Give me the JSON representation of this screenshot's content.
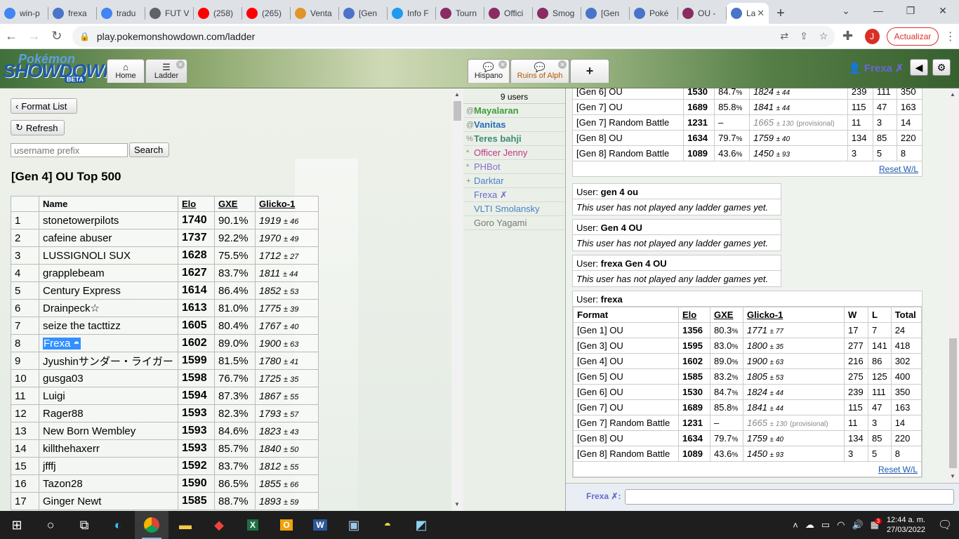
{
  "browser": {
    "tabs": [
      {
        "title": "win-p",
        "icon": "google-icon",
        "color": "#4285f4"
      },
      {
        "title": "frexa",
        "icon": "showdown-icon",
        "color": "#4a74c9"
      },
      {
        "title": "tradu",
        "icon": "google-icon",
        "color": "#4285f4"
      },
      {
        "title": "FUT V",
        "icon": "globe-icon",
        "color": "#5f6368"
      },
      {
        "title": "(258)",
        "icon": "youtube-icon",
        "color": "#ff0000"
      },
      {
        "title": "(265)",
        "icon": "youtube-icon",
        "color": "#ff0000"
      },
      {
        "title": "Venta",
        "icon": "tiger-icon",
        "color": "#e0952a"
      },
      {
        "title": "[Gen",
        "icon": "showdown-icon",
        "color": "#4a74c9"
      },
      {
        "title": "Info F",
        "icon": "twitter-icon",
        "color": "#1d9bf0"
      },
      {
        "title": "Tourn",
        "icon": "smogon-icon",
        "color": "#8a2b62"
      },
      {
        "title": "Offici",
        "icon": "smogon-icon",
        "color": "#8a2b62"
      },
      {
        "title": "Smog",
        "icon": "smogon-icon",
        "color": "#8a2b62"
      },
      {
        "title": "[Gen",
        "icon": "showdown-icon",
        "color": "#4a74c9"
      },
      {
        "title": "Poké",
        "icon": "showdown-icon",
        "color": "#4a74c9"
      },
      {
        "title": "OU -",
        "icon": "smogon-icon",
        "color": "#8a2b62"
      }
    ],
    "active_tab": {
      "title": "La",
      "icon": "showdown-icon",
      "color": "#4a74c9"
    },
    "url": "play.pokemonshowdown.com/ladder",
    "profile_initial": "J",
    "update_button": "Actualizar"
  },
  "showdown": {
    "logo": {
      "line1": "Pokémon",
      "line2": "SHOWDOWN",
      "line3": "BETA"
    },
    "tabs": [
      {
        "label": "Home",
        "icon": "home-icon"
      },
      {
        "label": "Ladder",
        "icon": "ladder-icon"
      }
    ],
    "room_tabs": [
      {
        "label": "Hispano",
        "icon": "chat-icon"
      },
      {
        "label": "Ruins of Alph",
        "icon": "chat-icon"
      }
    ],
    "new_room": "+",
    "username": "Frexa ✗"
  },
  "ladder": {
    "format_list_button": "Format List",
    "refresh_button": "Refresh",
    "search_placeholder": "username prefix",
    "search_button": "Search",
    "title": "[Gen 4] OU Top 500",
    "columns": [
      "",
      "Name",
      "Elo",
      "GXE",
      "Glicko-1"
    ],
    "rows": [
      {
        "rank": "1",
        "name": "stonetowerpilots",
        "elo": "1740",
        "gxe": "90.1%",
        "glicko": "1919",
        "dev": "± 46"
      },
      {
        "rank": "2",
        "name": "cafeine abuser",
        "elo": "1737",
        "gxe": "92.2%",
        "glicko": "1970",
        "dev": "± 49"
      },
      {
        "rank": "3",
        "name": "LUSSIGNOLI SUX",
        "elo": "1628",
        "gxe": "75.5%",
        "glicko": "1712",
        "dev": "± 27"
      },
      {
        "rank": "4",
        "name": "grapplebeam",
        "elo": "1627",
        "gxe": "83.7%",
        "glicko": "1811",
        "dev": "± 44"
      },
      {
        "rank": "5",
        "name": "Century Express",
        "elo": "1614",
        "gxe": "86.4%",
        "glicko": "1852",
        "dev": "± 53"
      },
      {
        "rank": "6",
        "name": "Drainpeck☆",
        "elo": "1613",
        "gxe": "81.0%",
        "glicko": "1775",
        "dev": "± 39"
      },
      {
        "rank": "7",
        "name": "seize the tacttizz",
        "elo": "1605",
        "gxe": "80.4%",
        "glicko": "1767",
        "dev": "± 40"
      },
      {
        "rank": "8",
        "name": "Frexa",
        "elo": "1602",
        "gxe": "89.0%",
        "glicko": "1900",
        "dev": "± 63",
        "highlight": true
      },
      {
        "rank": "9",
        "name": "Jyushinサンダー・ライガー",
        "elo": "1599",
        "gxe": "81.5%",
        "glicko": "1780",
        "dev": "± 41"
      },
      {
        "rank": "10",
        "name": "gusga03",
        "elo": "1598",
        "gxe": "76.7%",
        "glicko": "1725",
        "dev": "± 35"
      },
      {
        "rank": "11",
        "name": "Luigi",
        "elo": "1594",
        "gxe": "87.3%",
        "glicko": "1867",
        "dev": "± 55"
      },
      {
        "rank": "12",
        "name": "Rager88",
        "elo": "1593",
        "gxe": "82.3%",
        "glicko": "1793",
        "dev": "± 57"
      },
      {
        "rank": "13",
        "name": "New Born Wembley",
        "elo": "1593",
        "gxe": "84.6%",
        "glicko": "1823",
        "dev": "± 43"
      },
      {
        "rank": "14",
        "name": "killthehaxerr",
        "elo": "1593",
        "gxe": "85.7%",
        "glicko": "1840",
        "dev": "± 50"
      },
      {
        "rank": "15",
        "name": "jfffj",
        "elo": "1592",
        "gxe": "83.7%",
        "glicko": "1812",
        "dev": "± 55"
      },
      {
        "rank": "16",
        "name": "Tazon28",
        "elo": "1590",
        "gxe": "86.5%",
        "glicko": "1855",
        "dev": "± 66"
      },
      {
        "rank": "17",
        "name": "Ginger Newt",
        "elo": "1585",
        "gxe": "88.7%",
        "glicko": "1893",
        "dev": "± 59"
      }
    ]
  },
  "userlist": {
    "count": "9 users",
    "users": [
      {
        "group": "@",
        "name": "Mayalaran",
        "color": "#3f9b3f",
        "bold": true
      },
      {
        "group": "@",
        "name": "Vanitas",
        "color": "#2a6bb8",
        "bold": true
      },
      {
        "group": "%",
        "name": "Teres bahji",
        "color": "#3e8a78",
        "bold": true
      },
      {
        "group": "*",
        "name": "Officer Jenny",
        "color": "#c3338a",
        "bold": false
      },
      {
        "group": "*",
        "name": "PHBot",
        "color": "#8a6fd0",
        "bold": false
      },
      {
        "group": "+",
        "name": "Darktar",
        "color": "#4f7ec7",
        "bold": false
      },
      {
        "group": "",
        "name": "Frexa ✗",
        "color": "#6b67d3",
        "bold": false
      },
      {
        "group": "",
        "name": "VLTI Smolansky",
        "color": "#4a80c8",
        "bold": false
      },
      {
        "group": "",
        "name": "Goro Yagami",
        "color": "#777777",
        "bold": false
      }
    ]
  },
  "top_partial": {
    "rows": [
      {
        "format": "[Gen 6] OU",
        "elo": "1530",
        "gxe": "84.7",
        "glicko": "1824",
        "dev": "± 44",
        "provisional": "",
        "w": "239",
        "l": "111",
        "total": "350"
      },
      {
        "format": "[Gen 7] OU",
        "elo": "1689",
        "gxe": "85.8",
        "glicko": "1841",
        "dev": "± 44",
        "provisional": "",
        "w": "115",
        "l": "47",
        "total": "163"
      },
      {
        "format": "[Gen 7] Random Battle",
        "elo": "1231",
        "gxe": "–",
        "glicko": "1665",
        "dev": "± 130",
        "provisional": "(provisional)",
        "w": "11",
        "l": "3",
        "total": "14"
      },
      {
        "format": "[Gen 8] OU",
        "elo": "1634",
        "gxe": "79.7",
        "glicko": "1759",
        "dev": "± 40",
        "provisional": "",
        "w": "134",
        "l": "85",
        "total": "220"
      },
      {
        "format": "[Gen 8] Random Battle",
        "elo": "1089",
        "gxe": "43.6",
        "glicko": "1450",
        "dev": "± 93",
        "provisional": "",
        "w": "3",
        "l": "5",
        "total": "8"
      }
    ],
    "reset": "Reset W/L"
  },
  "empty_users": [
    {
      "prefix": "User: ",
      "name": "gen 4 ou",
      "message": "This user has not played any ladder games yet."
    },
    {
      "prefix": "User: ",
      "name": "Gen 4 OU",
      "message": "This user has not played any ladder games yet."
    },
    {
      "prefix": "User: ",
      "name": "frexa Gen 4 OU",
      "message": "This user has not played any ladder games yet."
    }
  ],
  "frexa": {
    "prefix": "User: ",
    "name": "frexa",
    "columns": [
      "Format",
      "Elo",
      "GXE",
      "Glicko-1",
      "W",
      "L",
      "Total"
    ],
    "rows": [
      {
        "format": "[Gen 1] OU",
        "elo": "1356",
        "gxe": "80.3",
        "glicko": "1771",
        "dev": "± 77",
        "provisional": "",
        "w": "17",
        "l": "7",
        "total": "24"
      },
      {
        "format": "[Gen 3] OU",
        "elo": "1595",
        "gxe": "83.0",
        "glicko": "1800",
        "dev": "± 35",
        "provisional": "",
        "w": "277",
        "l": "141",
        "total": "418"
      },
      {
        "format": "[Gen 4] OU",
        "elo": "1602",
        "gxe": "89.0",
        "glicko": "1900",
        "dev": "± 63",
        "provisional": "",
        "w": "216",
        "l": "86",
        "total": "302"
      },
      {
        "format": "[Gen 5] OU",
        "elo": "1585",
        "gxe": "83.2",
        "glicko": "1805",
        "dev": "± 53",
        "provisional": "",
        "w": "275",
        "l": "125",
        "total": "400"
      },
      {
        "format": "[Gen 6] OU",
        "elo": "1530",
        "gxe": "84.7",
        "glicko": "1824",
        "dev": "± 44",
        "provisional": "",
        "w": "239",
        "l": "111",
        "total": "350"
      },
      {
        "format": "[Gen 7] OU",
        "elo": "1689",
        "gxe": "85.8",
        "glicko": "1841",
        "dev": "± 44",
        "provisional": "",
        "w": "115",
        "l": "47",
        "total": "163"
      },
      {
        "format": "[Gen 7] Random Battle",
        "elo": "1231",
        "gxe": "–",
        "glicko": "1665",
        "dev": "± 130",
        "provisional": "(provisional)",
        "w": "11",
        "l": "3",
        "total": "14"
      },
      {
        "format": "[Gen 8] OU",
        "elo": "1634",
        "gxe": "79.7",
        "glicko": "1759",
        "dev": "± 40",
        "provisional": "",
        "w": "134",
        "l": "85",
        "total": "220"
      },
      {
        "format": "[Gen 8] Random Battle",
        "elo": "1089",
        "gxe": "43.6",
        "glicko": "1450",
        "dev": "± 93",
        "provisional": "",
        "w": "3",
        "l": "5",
        "total": "8"
      }
    ],
    "reset": "Reset W/L"
  },
  "chat": {
    "name": "Frexa ✗:"
  },
  "taskbar": {
    "apps": [
      "windows-start-icon",
      "cortana-icon",
      "task-view-icon",
      "edge-icon",
      "chrome-icon",
      "file-explorer-icon",
      "anydesk-icon",
      "excel-icon",
      "outlook-icon",
      "word-icon",
      "network-admin-icon",
      "chat-bubble-icon",
      "sticky-app-icon"
    ],
    "notification_badge": "3",
    "time": "12:44 a. m.",
    "date": "27/03/2022"
  }
}
